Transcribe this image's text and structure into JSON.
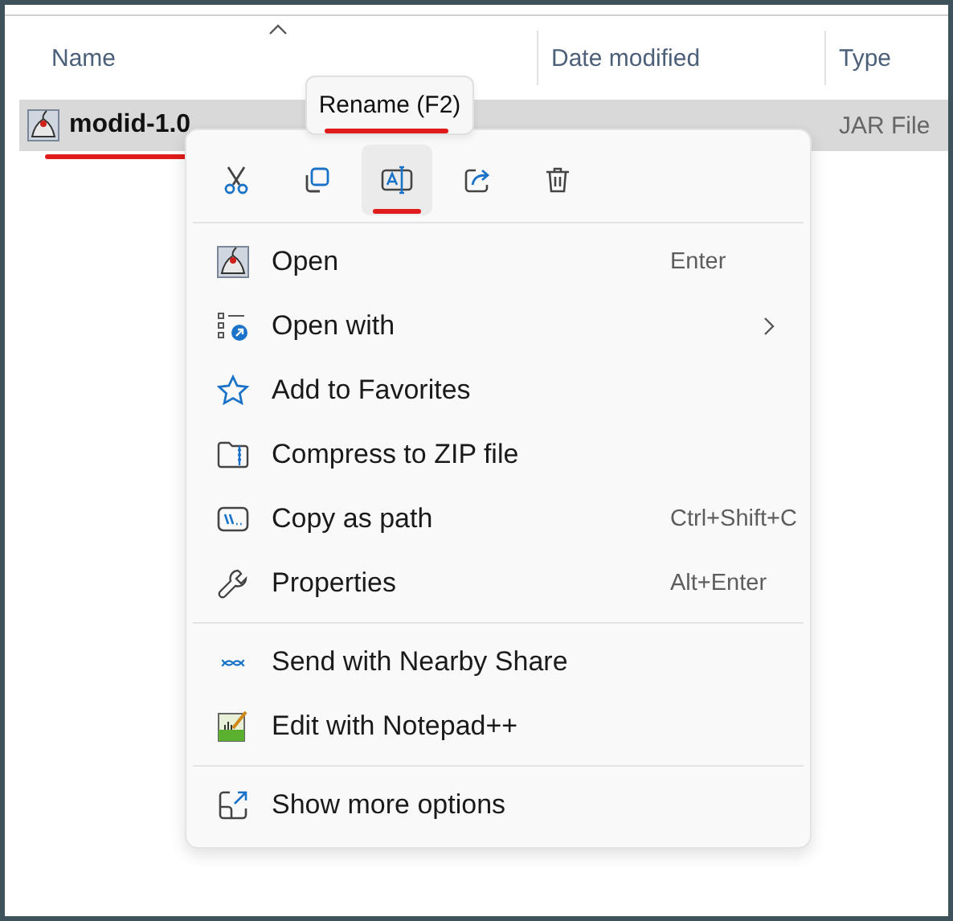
{
  "columns": [
    {
      "label": "Name",
      "sorted": true
    },
    {
      "label": "Date modified",
      "sorted": false
    },
    {
      "label": "Type",
      "sorted": false
    }
  ],
  "file": {
    "name": "modid-1.0",
    "type": "JAR File",
    "selected": true,
    "underlined": true
  },
  "tooltip": {
    "text": "Rename (F2)",
    "underlined": true
  },
  "toolbar": [
    {
      "kind": "cut",
      "selected": false,
      "underlined": false
    },
    {
      "kind": "copy",
      "selected": false,
      "underlined": false
    },
    {
      "kind": "rename",
      "selected": true,
      "underlined": true
    },
    {
      "kind": "share",
      "selected": false,
      "underlined": false
    },
    {
      "kind": "delete",
      "selected": false,
      "underlined": false
    }
  ],
  "menu": [
    [
      {
        "kind": "java",
        "label": "Open",
        "shortcut": "Enter"
      },
      {
        "kind": "openwith",
        "label": "Open with",
        "submenu": true
      },
      {
        "kind": "star",
        "label": "Add to Favorites"
      },
      {
        "kind": "zip",
        "label": "Compress to ZIP file"
      },
      {
        "kind": "path",
        "label": "Copy as path",
        "shortcut": "Ctrl+Shift+C"
      },
      {
        "kind": "wrench",
        "label": "Properties",
        "shortcut": "Alt+Enter"
      }
    ],
    [
      {
        "kind": "nearby",
        "label": "Send with Nearby Share"
      },
      {
        "kind": "notepad",
        "label": "Edit with Notepad++"
      }
    ],
    [
      {
        "kind": "more",
        "label": "Show more options"
      }
    ]
  ]
}
